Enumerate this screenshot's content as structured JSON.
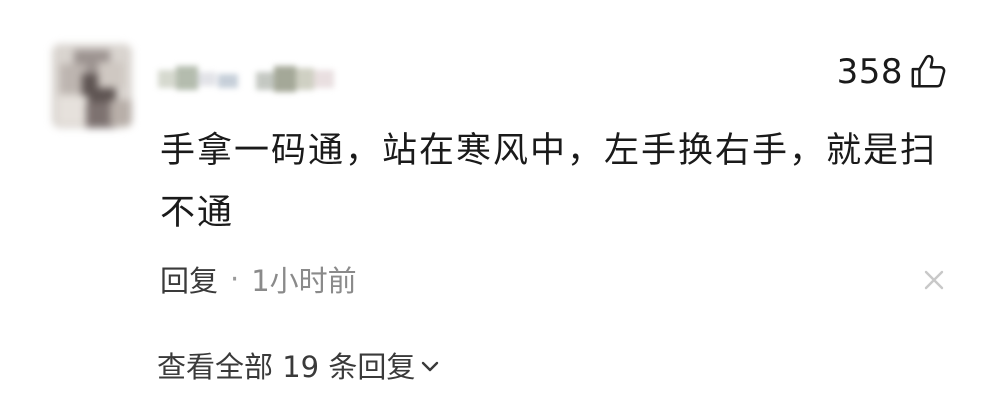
{
  "comment": {
    "likes": "358",
    "text_line1": "手拿一码通，站在寒风中，左手换右手，就是扫",
    "text_line2": "不通",
    "reply_label": "回复",
    "separator": "·",
    "time_ago": "1小时前",
    "view_all_replies": "查看全部 19 条回复"
  },
  "icons": {
    "like": "thumbs-up-icon",
    "close": "close-icon",
    "expand": "chevron-down-icon"
  },
  "colors": {
    "text_primary": "#1a1a1a",
    "text_secondary": "#8a8a8a",
    "icon_close": "#c8c8c8"
  }
}
